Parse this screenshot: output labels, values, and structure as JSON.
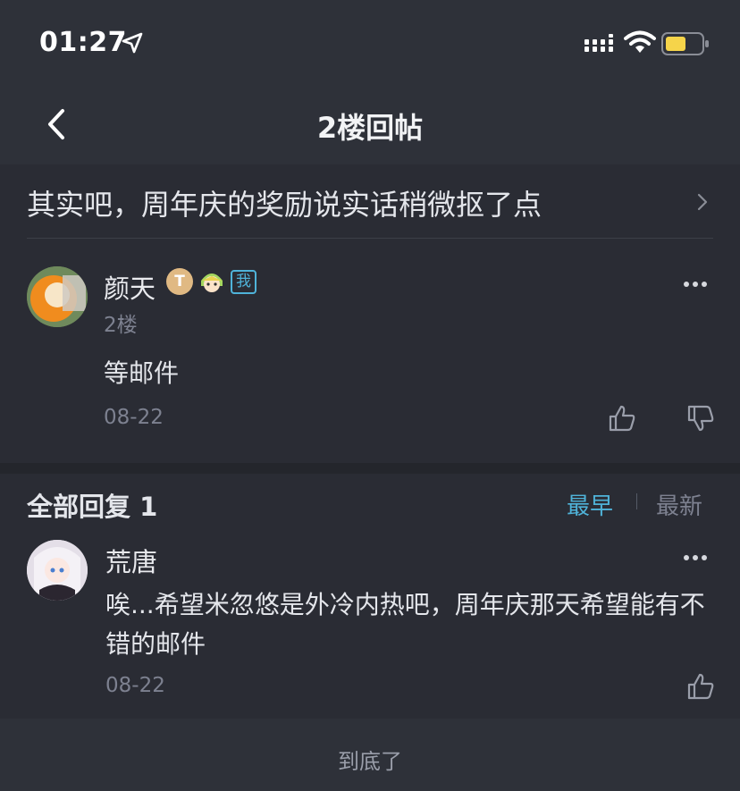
{
  "status_bar": {
    "time": "01:27",
    "icons": [
      "location-arrow-icon",
      "signal-icon",
      "wifi-icon",
      "battery-icon"
    ]
  },
  "nav": {
    "title": "2楼回帖",
    "back_icon": "chevron-left-icon"
  },
  "thread": {
    "title": "其实吧，周年庆的奖励说实话稍微抠了点"
  },
  "post": {
    "author": "颜天",
    "badge_t": "T",
    "badge_me": "我",
    "floor": "2楼",
    "content": "等邮件",
    "date": "08-22"
  },
  "replies": {
    "header": "全部回复 1",
    "sort_earliest": "最早",
    "sort_newest": "最新",
    "items": [
      {
        "author": "荒唐",
        "content": "唉...希望米忽悠是外冷内热吧，周年庆那天希望能有不错的邮件",
        "date": "08-22"
      }
    ]
  },
  "footer": {
    "end_text": "到底了"
  },
  "colors": {
    "background": "#2e3139",
    "panel": "#2a2c34",
    "accent": "#4fb3d9",
    "muted_text": "#7d8190"
  }
}
